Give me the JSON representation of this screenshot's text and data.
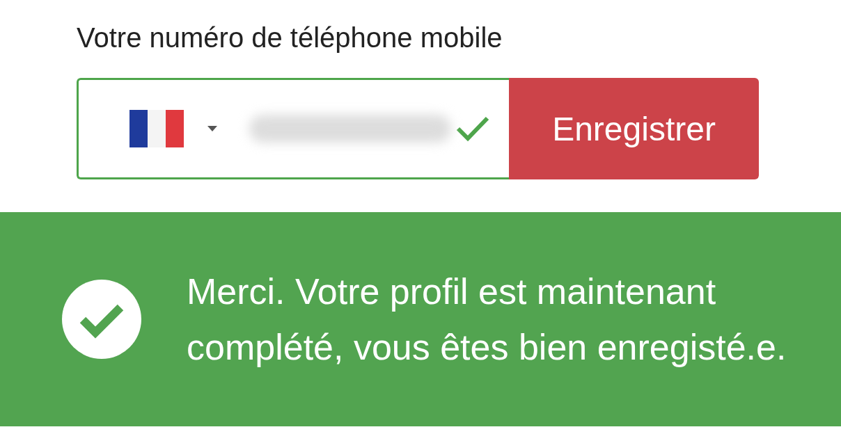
{
  "phone_field": {
    "label": "Votre numéro de téléphone mobile",
    "valid": true,
    "button": "Enregistrer"
  },
  "alert": {
    "kind": "success",
    "message": "Merci. Votre profil est maintenant complété, vous êtes bien enregisté.e."
  }
}
